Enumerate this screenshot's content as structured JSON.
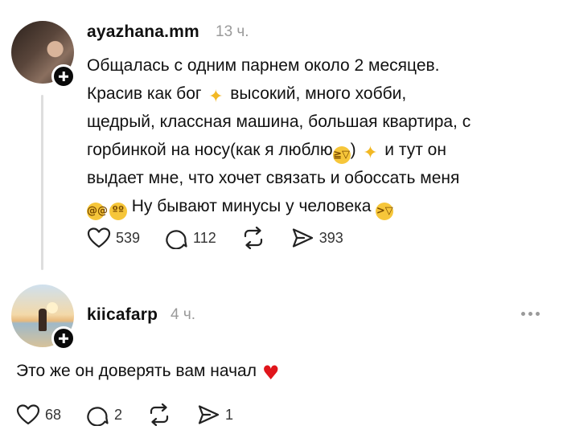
{
  "post": {
    "username": "ayazhana.mm",
    "time": "13 ч.",
    "lines": [
      "Общалась с одним парнем около 2 месяцев.",
      "Красив как бог",
      "высокий, много хобби,",
      "щедрый, классная машина, большая квартира, с",
      "горбинкой на носу(как я люблю",
      ")",
      "и тут он",
      "выдает мне, что хочет связать и обоссать меня",
      "Ну бывают минусы у человека"
    ],
    "likes": "539",
    "comments": "112",
    "shares": "393"
  },
  "reply": {
    "username": "kiicafarp",
    "time": "4 ч.",
    "text": "Это же он доверять вам начал",
    "likes": "68",
    "comments": "2",
    "shares": "1"
  },
  "icons": {
    "sparkle": "sparkles-emoji",
    "laugh": "laughing-face-emoji",
    "dizzy": "dizzy-face-emoji",
    "pleading": "pleading-face-emoji",
    "rofl": "rolling-laughing-emoji",
    "heart": "red-heart-emoji"
  },
  "colors": {
    "text": "#101010",
    "muted": "#9a9a9a",
    "heart": "#e0151b"
  }
}
